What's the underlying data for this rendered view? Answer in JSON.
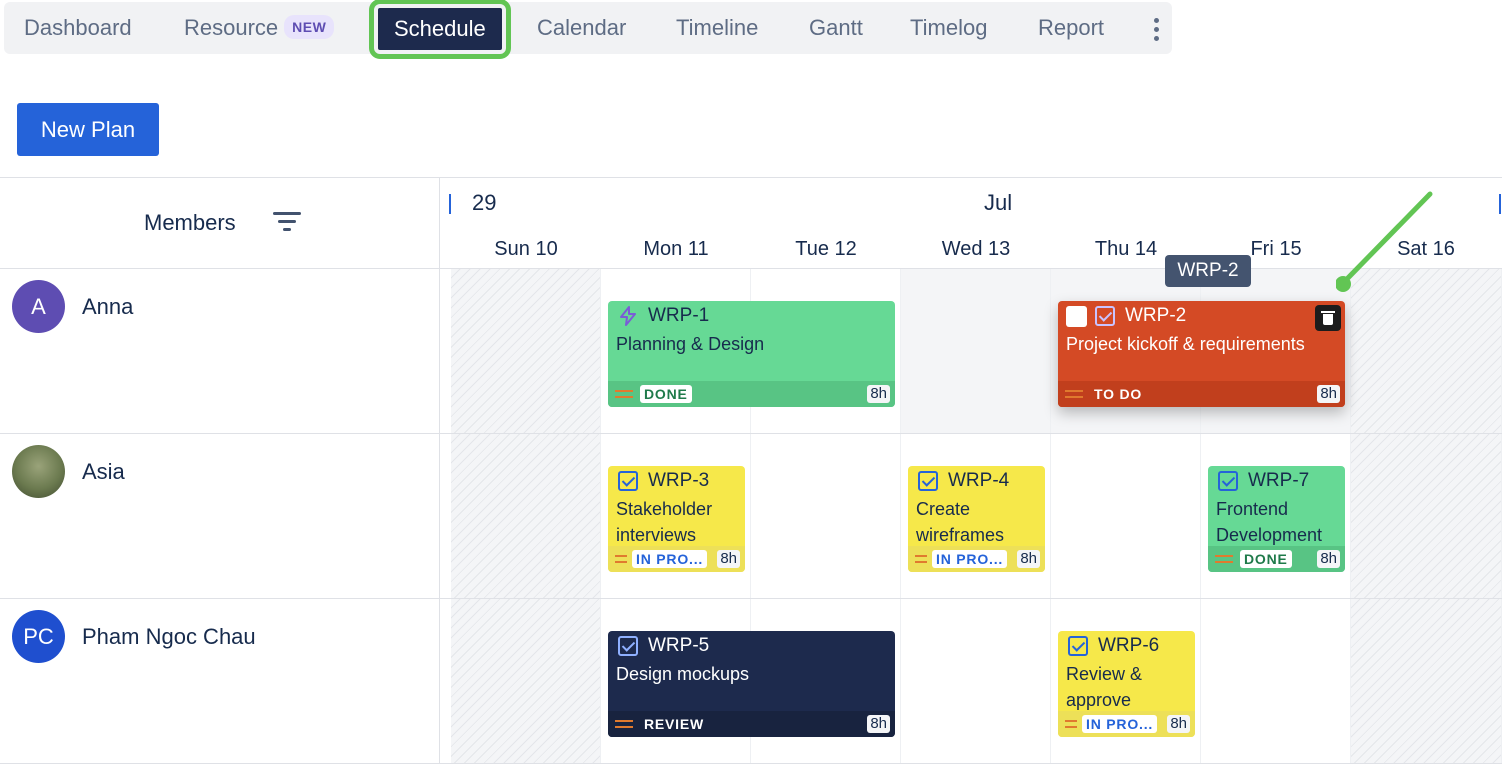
{
  "tabs": [
    {
      "label": "Dashboard"
    },
    {
      "label": "Resource",
      "badge": "NEW"
    },
    {
      "label": "Schedule",
      "active": true
    },
    {
      "label": "Calendar"
    },
    {
      "label": "Timeline"
    },
    {
      "label": "Gantt"
    },
    {
      "label": "Timelog"
    },
    {
      "label": "Report"
    }
  ],
  "toolbar": {
    "new_plan_label": "New Plan"
  },
  "grid": {
    "members_label": "Members",
    "week_number": "29",
    "month": "Jul",
    "days": [
      "Sun 10",
      "Mon 11",
      "Tue 12",
      "Wed 13",
      "Thu 14",
      "Fri 15",
      "Sat 16"
    ]
  },
  "members": [
    {
      "initials": "A",
      "name": "Anna",
      "avatar_color": "#5e4db2"
    },
    {
      "initials": "",
      "name": "Asia",
      "avatar_color": "#6b7a4f"
    },
    {
      "initials": "PC",
      "name": "Pham Ngoc Chau",
      "avatar_color": "#1f4fcf"
    }
  ],
  "tasks": {
    "wrp1": {
      "key": "WRP-1",
      "title": "Planning & Design",
      "status": "DONE",
      "hours": "8h"
    },
    "wrp2": {
      "key": "WRP-2",
      "title": "Project kickoff & requirements",
      "status": "TO DO",
      "hours": "8h"
    },
    "wrp3": {
      "key": "WRP-3",
      "title": "Stakeholder interviews",
      "status": "IN PRO...",
      "hours": "8h"
    },
    "wrp4": {
      "key": "WRP-4",
      "title": "Create wireframes",
      "status": "IN PRO...",
      "hours": "8h"
    },
    "wrp7": {
      "key": "WRP-7",
      "title": "Frontend Development",
      "status": "DONE",
      "hours": "8h"
    },
    "wrp5": {
      "key": "WRP-5",
      "title": "Design mockups",
      "status": "REVIEW",
      "hours": "8h"
    },
    "wrp6": {
      "key": "WRP-6",
      "title": "Review & approve",
      "status": "IN PRO...",
      "hours": "8h"
    }
  },
  "tooltip": "WRP-2",
  "colors": {
    "accent": "#2563d9",
    "highlight": "#62c554",
    "done": "#66d995",
    "in_progress": "#f6e84a",
    "review": "#1d2a4d",
    "todo": "#d44a25"
  }
}
